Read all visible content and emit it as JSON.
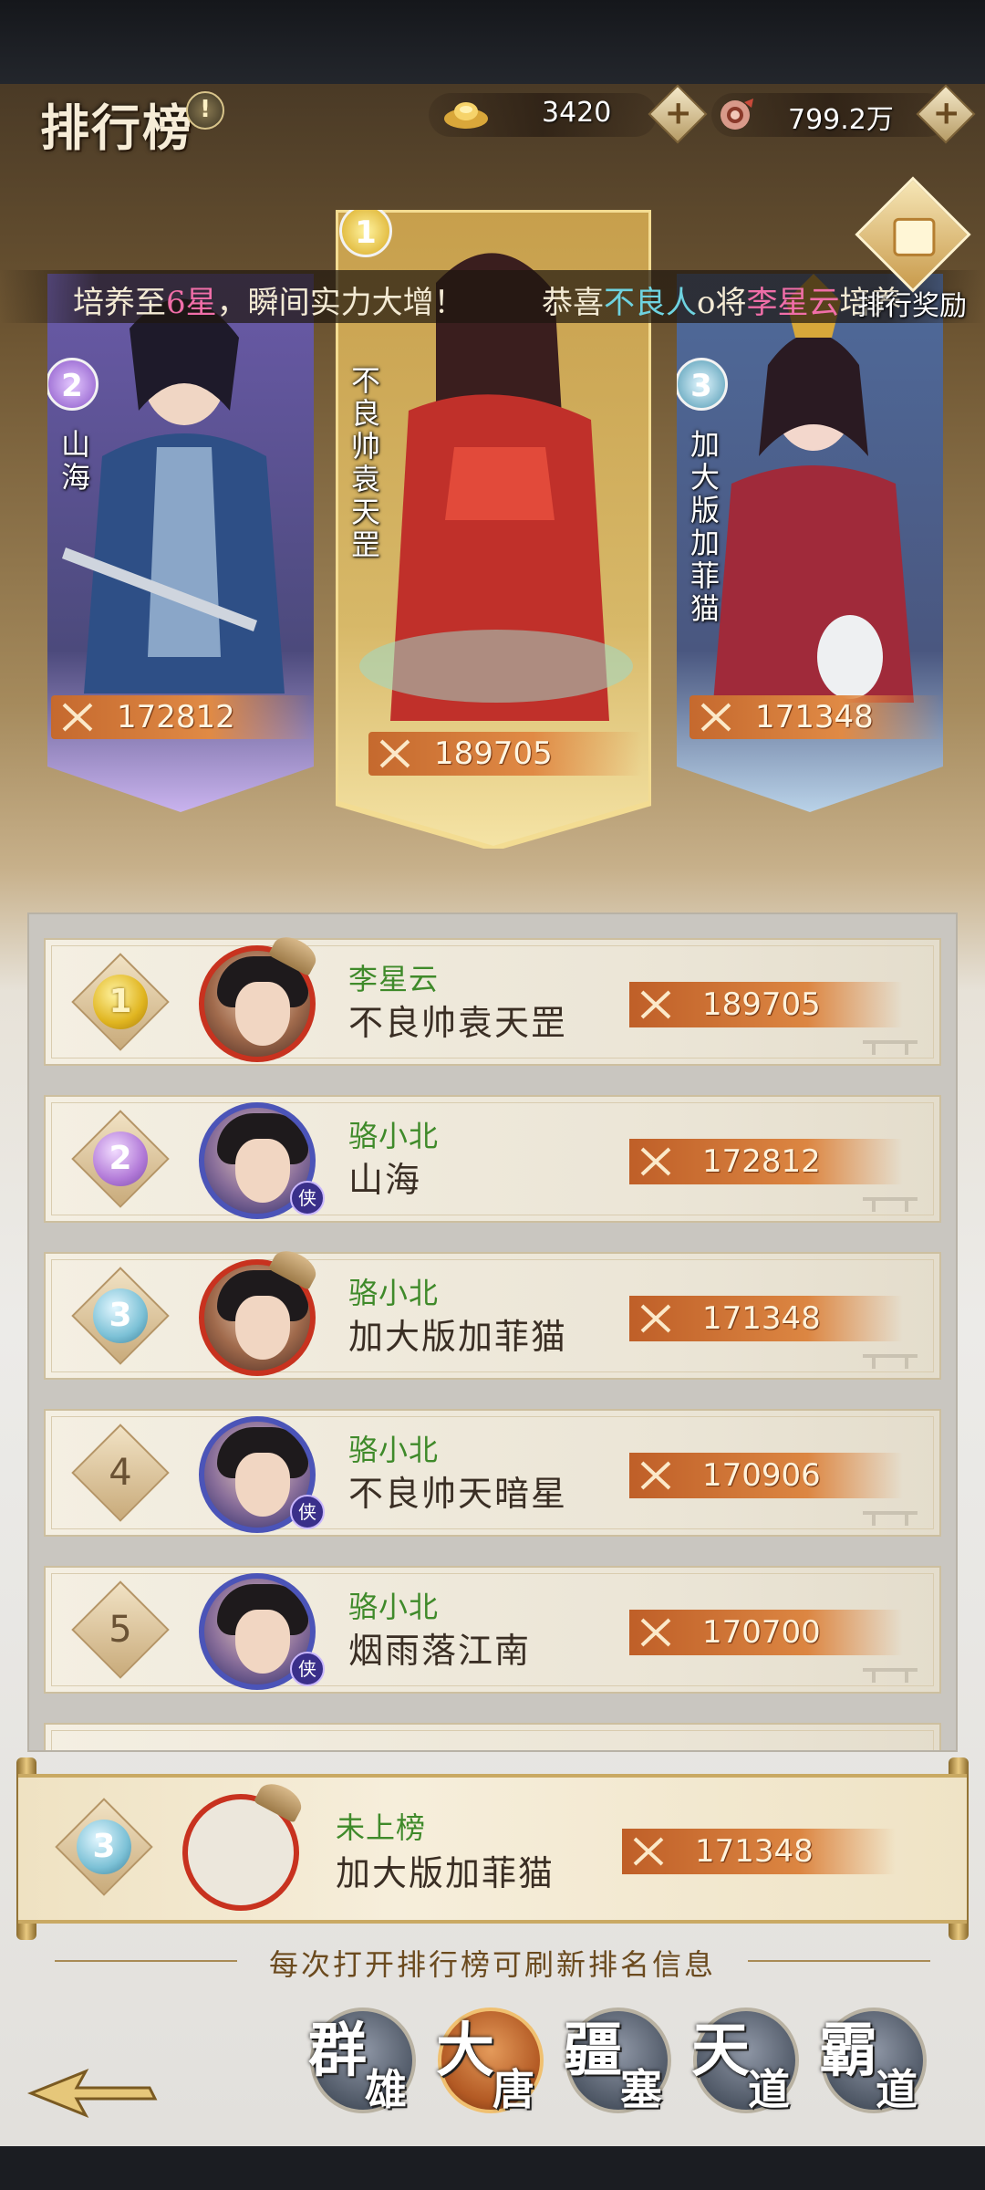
{
  "header": {
    "title": "排行榜",
    "info_icon": "!",
    "resources": [
      {
        "icon": "gold-ingot-icon",
        "value": "3420",
        "add_label": "+"
      },
      {
        "icon": "coin-pouch-icon",
        "value": "799.2万",
        "add_label": "+"
      }
    ]
  },
  "marquee": {
    "msg1_prefix": "培养至",
    "msg1_highlight": "6星",
    "msg1_suffix": "，瞬间实力大增！",
    "msg2_prefix": "恭喜",
    "msg2_highlight1": "不良人",
    "msg2_mid": "o将",
    "msg2_highlight2": "李星云",
    "msg2_suffix": "培养"
  },
  "reward": {
    "label": "排行奖励"
  },
  "podium": [
    {
      "rank": "2",
      "name": "山海",
      "power": "172812"
    },
    {
      "rank": "1",
      "name": "不良帅袁天罡",
      "power": "189705"
    },
    {
      "rank": "3",
      "name": "加大版加菲猫",
      "power": "171348"
    }
  ],
  "list": [
    {
      "rank": "1",
      "player": "李星云",
      "hero": "不良帅袁天罡",
      "power": "189705"
    },
    {
      "rank": "2",
      "player": "骆小北",
      "hero": "山海",
      "power": "172812"
    },
    {
      "rank": "3",
      "player": "骆小北",
      "hero": "加大版加菲猫",
      "power": "171348"
    },
    {
      "rank": "4",
      "player": "骆小北",
      "hero": "不良帅天暗星",
      "power": "170906"
    },
    {
      "rank": "5",
      "player": "骆小北",
      "hero": "烟雨落江南",
      "power": "170700"
    }
  ],
  "my_rank": {
    "rank": "3",
    "status": "未上榜",
    "hero": "加大版加菲猫",
    "power": "171348"
  },
  "hint": "每次打开排行榜可刷新排名信息",
  "tabs": [
    {
      "c1": "群",
      "c2": "雄"
    },
    {
      "c1": "大",
      "c2": "唐"
    },
    {
      "c1": "疆",
      "c2": "塞"
    },
    {
      "c1": "天",
      "c2": "道"
    },
    {
      "c1": "霸",
      "c2": "道"
    }
  ],
  "colors": {
    "gold_rank": "#e0b520",
    "silver_rank": "#b27ad8",
    "bronze_rank": "#7cc1d6",
    "player_name": "#3f8a2a",
    "power_banner": "#dc8642",
    "active_tab": "#b35a24"
  }
}
